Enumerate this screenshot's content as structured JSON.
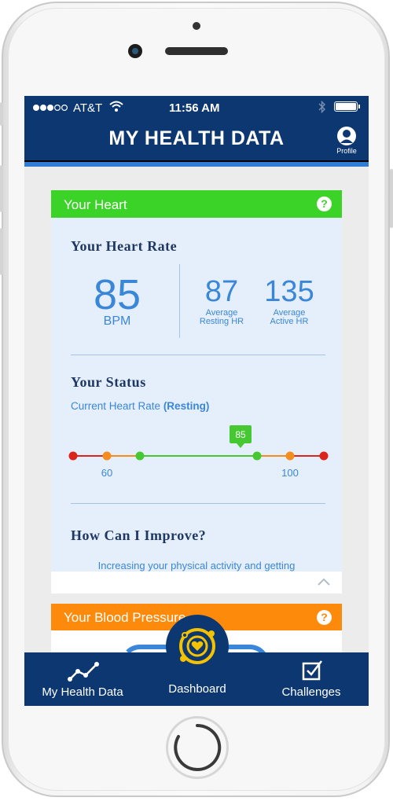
{
  "status_bar": {
    "carrier": "AT&T",
    "time": "11:56 AM"
  },
  "header": {
    "title": "MY HEALTH DATA",
    "profile_label": "Profile"
  },
  "heart_card": {
    "title": "Your Heart",
    "help_glyph": "?",
    "heart_rate_heading": "Your Heart Rate",
    "bpm_value": "85",
    "bpm_unit": "BPM",
    "resting_value": "87",
    "resting_label_line1": "Average",
    "resting_label_line2": "Resting HR",
    "active_value": "135",
    "active_label_line1": "Average",
    "active_label_line2": "Active HR",
    "status_heading": "Your Status",
    "status_caption": "Current Heart Rate",
    "status_mode": "(Resting)",
    "gauge_marker": "85",
    "gauge_low_label": "60",
    "gauge_high_label": "100",
    "improve_heading": "How Can I Improve?",
    "improve_text": "Increasing your physical activity and getting"
  },
  "bp_card": {
    "title": "Your Blood Pressure",
    "help_glyph": "?"
  },
  "tabs": {
    "my_health_data": "My Health Data",
    "dashboard": "Dashboard",
    "challenges": "Challenges"
  },
  "colors": {
    "navy": "#0c3771",
    "accent_blue": "#3a86d9",
    "heart_green": "#3cd329",
    "bp_orange": "#fd8a0a",
    "gauge_red": "#d9251c",
    "gauge_orange": "#f58d1e",
    "gauge_green": "#46c833",
    "dashboard_gold": "#f5c200"
  },
  "icons": {
    "signal": "signal-dots-icon",
    "wifi": "wifi-icon",
    "bluetooth": "bluetooth-icon",
    "battery": "battery-icon",
    "profile": "profile-icon",
    "help": "help-icon",
    "chevron": "chevron-up-icon",
    "my_health_data": "line-chart-icon",
    "dashboard": "heart-orbit-icon",
    "challenges": "checkbox-icon"
  }
}
